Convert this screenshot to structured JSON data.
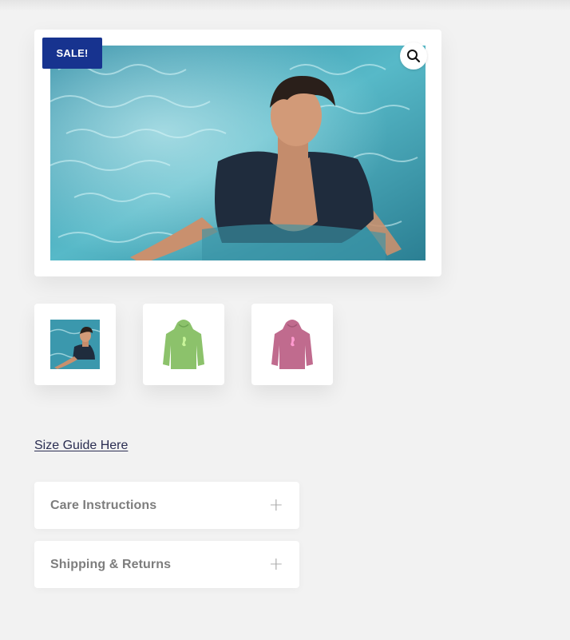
{
  "gallery": {
    "sale_badge": "SALE!",
    "zoom_icon": "search-icon",
    "main_image_alt": "Man in swimming pool wearing dark shirt",
    "thumbnails": [
      {
        "alt": "Man in pool thumbnail"
      },
      {
        "alt": "Green hoodie"
      },
      {
        "alt": "Pink hoodie"
      }
    ]
  },
  "links": {
    "size_guide": "Size Guide Here"
  },
  "accordions": [
    {
      "title": "Care Instructions",
      "icon": "+"
    },
    {
      "title": "Shipping & Returns",
      "icon": "+"
    }
  ],
  "colors": {
    "badge_bg": "#17338f",
    "link": "#2b2e52",
    "pool": "#3aa0b3",
    "hoodie_green": "#8cc26b",
    "hoodie_pink": "#c06b8e"
  }
}
